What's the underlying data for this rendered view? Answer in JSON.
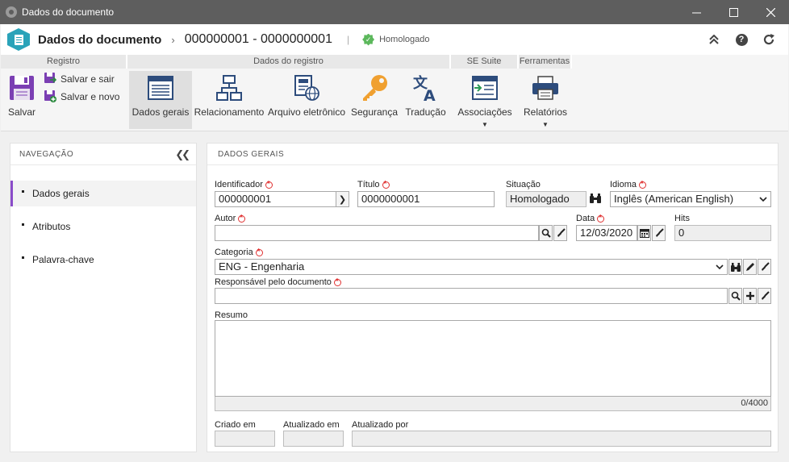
{
  "window": {
    "title": "Dados do documento"
  },
  "header": {
    "title": "Dados do documento",
    "doc_id": "000000001 - 0000000001",
    "separator": "|",
    "status": "Homologado"
  },
  "ribbon": {
    "groups": {
      "registro": "Registro",
      "dados_registro": "Dados do registro",
      "se_suite": "SE Suite",
      "ferramentas": "Ferramentas"
    },
    "save": "Salvar",
    "save_exit": "Salvar e sair",
    "save_new": "Salvar e novo",
    "dados_gerais": "Dados gerais",
    "relacionamento": "Relacionamento",
    "arquivo": "Arquivo eletrônico",
    "seguranca": "Segurança",
    "traducao": "Tradução",
    "associacoes": "Associações",
    "relatorios": "Relatórios"
  },
  "navigation": {
    "title": "NAVEGAÇÃO",
    "items": [
      "Dados gerais",
      "Atributos",
      "Palavra-chave"
    ]
  },
  "main": {
    "section_title": "DADOS GERAIS",
    "fields": {
      "identificador": {
        "label": "Identificador",
        "value": "000000001"
      },
      "titulo": {
        "label": "Título",
        "value": "0000000001"
      },
      "situacao": {
        "label": "Situação",
        "value": "Homologado"
      },
      "idioma": {
        "label": "Idioma",
        "value": "Inglês (American English)"
      },
      "autor": {
        "label": "Autor",
        "value": ""
      },
      "data": {
        "label": "Data",
        "value": "12/03/2020"
      },
      "hits": {
        "label": "Hits",
        "value": "0"
      },
      "categoria": {
        "label": "Categoria",
        "value": "ENG - Engenharia"
      },
      "responsavel": {
        "label": "Responsável pelo documento",
        "value": ""
      },
      "resumo": {
        "label": "Resumo",
        "value": "",
        "counter": "0/4000"
      },
      "criado_em": {
        "label": "Criado em",
        "value": ""
      },
      "atualizado_em": {
        "label": "Atualizado em",
        "value": ""
      },
      "atualizado_por": {
        "label": "Atualizado por",
        "value": ""
      }
    }
  }
}
